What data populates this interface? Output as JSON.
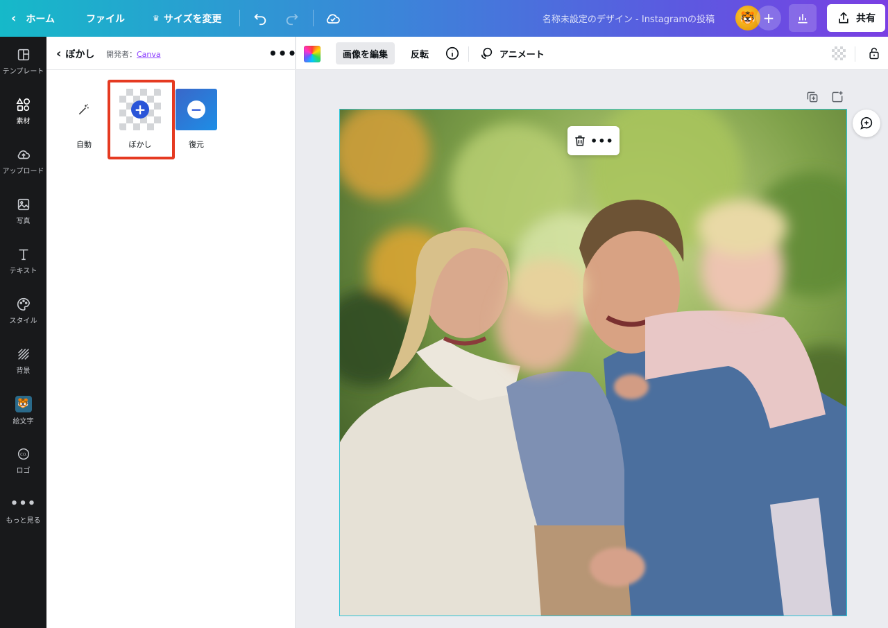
{
  "topbar": {
    "home": "ホーム",
    "file": "ファイル",
    "resize": "サイズを変更",
    "title": "名称未設定のデザイン - Instagramの投稿",
    "share": "共有"
  },
  "rail": [
    {
      "label": "テンプレート",
      "icon": "template-icon"
    },
    {
      "label": "素材",
      "icon": "elements-icon"
    },
    {
      "label": "アップロード",
      "icon": "upload-icon"
    },
    {
      "label": "写真",
      "icon": "photo-icon"
    },
    {
      "label": "テキスト",
      "icon": "text-icon"
    },
    {
      "label": "スタイル",
      "icon": "palette-icon"
    },
    {
      "label": "背景",
      "icon": "background-icon"
    },
    {
      "label": "絵文字",
      "icon": "emoji-icon"
    },
    {
      "label": "ロゴ",
      "icon": "logo-icon"
    },
    {
      "label": "もっと見る",
      "icon": "more-icon"
    }
  ],
  "panel": {
    "title": "ぼかし",
    "developer_label": "開発者：",
    "developer_name": "Canva",
    "tools": [
      {
        "label": "自動",
        "icon": "magic-wand-icon"
      },
      {
        "label": "ぼかし",
        "icon": "plus-icon"
      },
      {
        "label": "復元",
        "icon": "minus-icon"
      }
    ]
  },
  "context_toolbar": {
    "edit_image": "画像を編集",
    "flip": "反転",
    "animate": "アニメート"
  },
  "colors": {
    "accent_purple": "#8b3dff",
    "highlight_red": "#e53a21",
    "selection_cyan": "#2ac4d6"
  }
}
